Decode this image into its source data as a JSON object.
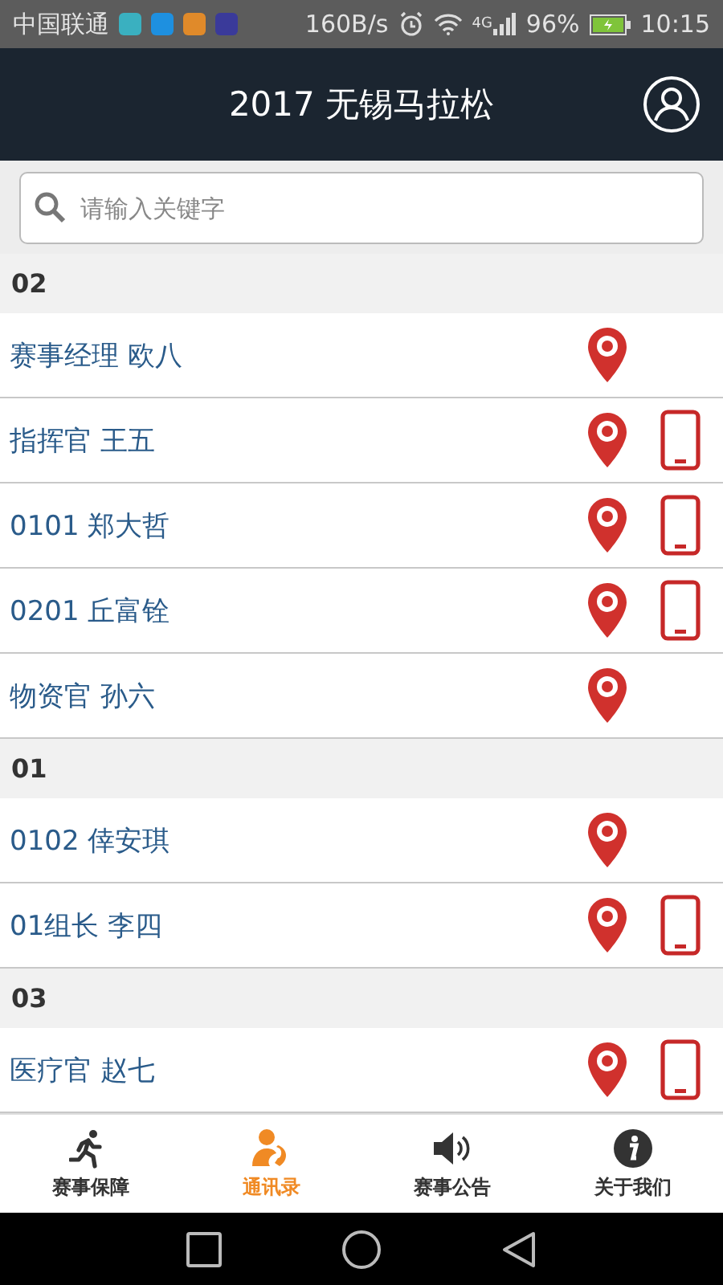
{
  "status_bar": {
    "carrier": "中国联通",
    "app_icons": [
      {
        "color": "#3ab0c0"
      },
      {
        "color": "#1e90e0"
      },
      {
        "color": "#e08a2a"
      },
      {
        "color": "#3a3a9a"
      }
    ],
    "speed": "160B/s",
    "network": "4G",
    "battery": "96%",
    "time": "10:15"
  },
  "header": {
    "title": "2017 无锡马拉松"
  },
  "search": {
    "placeholder": "请输入关键字"
  },
  "groups": [
    {
      "label": "02",
      "contacts": [
        {
          "name": "赛事经理 欧八",
          "phone": false
        },
        {
          "name": "指挥官 王五",
          "phone": true
        },
        {
          "name": "0101 郑大哲",
          "phone": true
        },
        {
          "name": "0201 丘富铨",
          "phone": true
        },
        {
          "name": "物资官 孙六",
          "phone": false
        }
      ]
    },
    {
      "label": "01",
      "contacts": [
        {
          "name": "0102 倖安琪",
          "phone": false
        },
        {
          "name": "01组长 李四",
          "phone": true
        }
      ]
    },
    {
      "label": "03",
      "contacts": [
        {
          "name": "医疗官 赵七",
          "phone": true
        }
      ]
    }
  ],
  "tabs": [
    {
      "kind": "runner",
      "label": "赛事保障",
      "selected": false
    },
    {
      "kind": "contacts",
      "label": "通讯录",
      "selected": true
    },
    {
      "kind": "speaker",
      "label": "赛事公告",
      "selected": false
    },
    {
      "kind": "info",
      "label": "关于我们",
      "selected": false
    }
  ]
}
